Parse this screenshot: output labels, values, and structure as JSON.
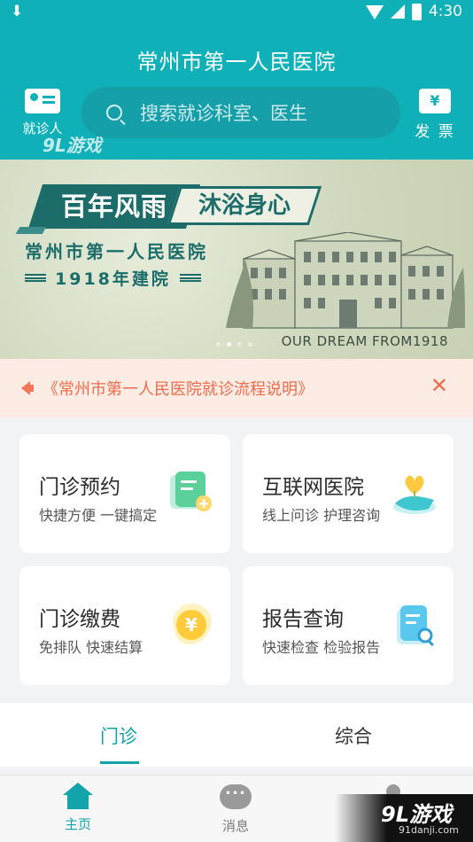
{
  "status_bar": {
    "time": "4:30",
    "download_icon": "download-icon",
    "wifi_icon": "wifi-icon",
    "signal_icon": "signal-icon",
    "battery_icon": "battery-icon"
  },
  "header": {
    "title": "常州市第一人民医院",
    "card_label": "就诊人",
    "search_placeholder": "搜索就诊科室、医生",
    "invoice_label": "发 票",
    "invoice_symbol": "¥"
  },
  "banner": {
    "tag1": "百年风雨",
    "tag2": "沐浴身心",
    "hospital_name": "常州市第一人民医院",
    "year_text": "1918年建院",
    "dream_text": "OUR DREAM FROM1918",
    "pages": 4,
    "active_page": 2
  },
  "notice": {
    "text": "《常州市第一人民医院就诊流程说明》",
    "close_symbol": "✕"
  },
  "services": [
    {
      "title": "门诊预约",
      "subtitle": "快捷方便 一键搞定",
      "icon": "appointment-icon"
    },
    {
      "title": "互联网医院",
      "subtitle": "线上问诊 护理咨询",
      "icon": "internet-hospital-icon"
    },
    {
      "title": "门诊缴费",
      "subtitle": "免排队 快速结算",
      "icon": "payment-icon"
    },
    {
      "title": "报告查询",
      "subtitle": "快速检查 检验报告",
      "icon": "report-icon"
    }
  ],
  "tabs": {
    "outpatient": "门诊",
    "general": "综合",
    "active": "outpatient"
  },
  "bottom_nav": {
    "home": "主页",
    "messages": "消息"
  },
  "watermark": {
    "brand": "9L游戏",
    "domain": "91danji.com"
  },
  "colors": {
    "primary": "#0fb0b8",
    "accent": "#12a3ab",
    "notice_bg": "#fcece3",
    "notice_text": "#ef6b4c",
    "banner_green": "#1c6d6a"
  }
}
